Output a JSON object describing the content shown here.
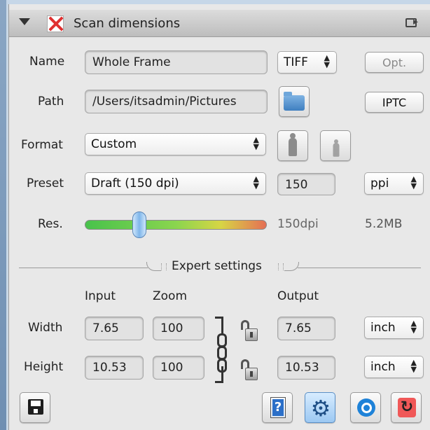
{
  "panel": {
    "title": "Scan dimensions"
  },
  "rows": {
    "name": {
      "label": "Name",
      "value": "Whole Frame",
      "filetype": "TIFF",
      "options_label": "Opt."
    },
    "path": {
      "label": "Path",
      "value": "/Users/itsadmin/Pictures",
      "iptc_label": "IPTC"
    },
    "format": {
      "label": "Format",
      "value": "Custom"
    },
    "preset": {
      "label": "Preset",
      "value": "Draft (150 dpi)",
      "dpi_value": "150",
      "unit": "ppi"
    },
    "resolution": {
      "label": "Res.",
      "dpi_text": "150dpi",
      "size_text": "5.2MB",
      "slider_fraction": 0.3
    }
  },
  "expert": {
    "title": "Expert settings",
    "col_input": "Input",
    "col_zoom": "Zoom",
    "col_output": "Output",
    "width": {
      "label": "Width",
      "input": "7.65",
      "zoom": "100",
      "output": "7.65",
      "unit": "inch"
    },
    "height": {
      "label": "Height",
      "input": "10.53",
      "zoom": "100",
      "output": "10.53",
      "unit": "inch"
    }
  },
  "icons": {
    "disclosure": "triangle-down-icon",
    "scan_area": "red-x-icon",
    "popout": "popout-icon",
    "folder": "folder-icon",
    "portrait": "portrait-icon",
    "landscape": "landscape-icon",
    "save": "save-icon",
    "help": "help-icon",
    "settings": "gear-icon",
    "preview": "magnify-icon",
    "refresh": "refresh-icon"
  }
}
